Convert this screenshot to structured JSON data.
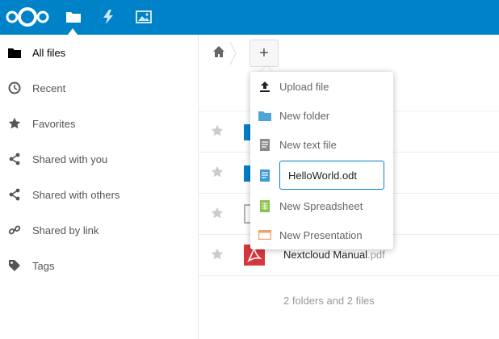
{
  "colors": {
    "header_bg": "#0082c9",
    "folder_blue": "#0082c9",
    "pdf_red": "#d6373c",
    "menu_folder": "#4ea5d8",
    "menu_doc_blue": "#3a9bd9",
    "menu_sheet_green": "#8bc34a",
    "menu_pres_orange": "#f2a06a"
  },
  "header": {
    "apps": [
      {
        "icon": "files-folder-icon"
      },
      {
        "icon": "activity-lightning-icon"
      },
      {
        "icon": "gallery-image-icon"
      }
    ]
  },
  "sidebar": {
    "items": [
      {
        "label": "All files",
        "icon": "folder-icon"
      },
      {
        "label": "Recent",
        "icon": "clock-icon"
      },
      {
        "label": "Favorites",
        "icon": "star-icon"
      },
      {
        "label": "Shared with you",
        "icon": "share-icon"
      },
      {
        "label": "Shared with others",
        "icon": "share-icon"
      },
      {
        "label": "Shared by link",
        "icon": "link-icon"
      },
      {
        "label": "Tags",
        "icon": "tag-icon"
      }
    ]
  },
  "toolbar": {
    "add_label": "+"
  },
  "menu": {
    "items": [
      {
        "label": "Upload file",
        "icon": "upload-icon"
      },
      {
        "label": "New folder",
        "icon": "folder-icon"
      },
      {
        "label": "New text file",
        "icon": "text-file-icon"
      },
      {
        "label": "",
        "icon": "document-icon",
        "input_value": "HelloWorld.odt"
      },
      {
        "label": "New Spreadsheet",
        "icon": "spreadsheet-icon"
      },
      {
        "label": "New Presentation",
        "icon": "presentation-icon"
      }
    ]
  },
  "files": {
    "rows": [
      {
        "type": "folder"
      },
      {
        "type": "folder"
      },
      {
        "type": "file"
      },
      {
        "type": "pdf",
        "name": "Nextcloud Manual",
        "ext": ".pdf"
      }
    ],
    "summary": "2 folders and 2 files"
  }
}
